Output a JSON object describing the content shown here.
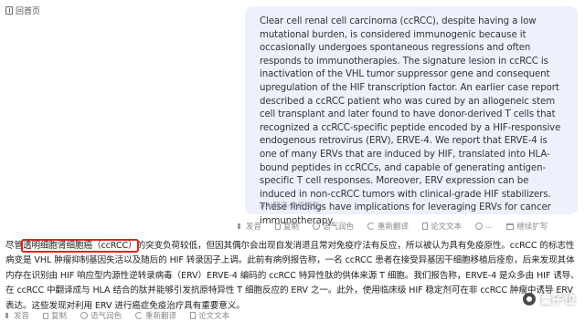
{
  "header": {
    "home_label": "回首页"
  },
  "bubble": {
    "text": "Clear cell renal cell carcinoma (ccRCC), despite having a low mutational burden, is considered immunogenic because it occasionally undergoes spontaneous regressions and often responds to immunotherapies. The signature lesion in ccRCC is inactivation of the VHL tumor suppressor gene and consequent upregulation of the HIF transcription factor. An earlier case report described a ccRCC patient who was cured by an allogeneic stem cell transplant and later found to have donor-derived T cells that recognized a ccRCC-specific peptide encoded by a HIF-responsive endogenous retrovirus (ERV), ERVE-4. We report that ERVE-4 is one of many ERVs that are induced by HIF, translated into HLA-bound peptides in ccRCCs, and capable of generating antigen-specific T cell responses. Moreover, ERV expression can be induced in non-ccRCC tumors with clinical-grade HIF stabilizers. These findings have implications for leveraging ERVs for cancer immunotherapy.",
    "model_tag": "#AI翻译-高级模型"
  },
  "actions": {
    "read": "发音",
    "copy": "复制",
    "tone": "语气润色",
    "retranslate": "重新翻译",
    "summary": "论文文本",
    "more": "...",
    "expand": "继续扩写"
  },
  "translation": {
    "prefix": "尽管",
    "highlight": "透明细胞肾细胞癌（ccRCC）",
    "rest": "的突变负荷较低，但因其偶尔会出现自发消退且常对免疫疗法有反应，所以被认为具有免疫原性。ccRCC 的标志性病变是 VHL 肿瘤抑制基因失活以及随后的 HIF 转录因子上调。此前有病例报告称，一名 ccRCC 患者在接受异基因干细胞移植后痊愈，后来发现其体内存在识别由 HIF 响应型内源性逆转录病毒（ERV）ERVE-4 编码的 ccRCC 特异性肽的供体来源 T 细胞。我们报告称，ERVE-4 是众多由 HIF 诱导、在 ccRCC 中翻译成与 HLA 结合的肽并能够引发抗原特异性 T 细胞反应的 ERV 之一。此外，使用临床级 HIF 稳定剂可在非 ccRCC 肿瘤中诱导 ERV 表达。这些发现对利用 ERV 进行癌症免疫治疗具有重要意义。"
  },
  "watermark": {
    "text": "量子位"
  }
}
